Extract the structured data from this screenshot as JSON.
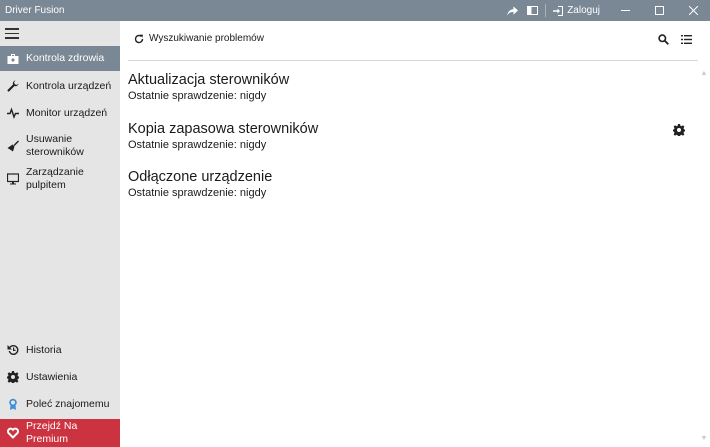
{
  "window": {
    "title": "Driver Fusion",
    "login_label": "Zaloguj"
  },
  "sidebar": {
    "items": [
      {
        "label": "Kontrola zdrowia",
        "icon": "briefcase-icon",
        "active": true
      },
      {
        "label": "Kontrola urządzeń",
        "icon": "wrench-icon"
      },
      {
        "label": "Monitor urządzeń",
        "icon": "pulse-icon"
      },
      {
        "label": "Usuwanie sterowników",
        "icon": "broom-icon"
      },
      {
        "label": "Zarządzanie pulpitem",
        "icon": "monitor-icon"
      }
    ],
    "bottom_items": [
      {
        "label": "Historia",
        "icon": "history-icon"
      },
      {
        "label": "Ustawienia",
        "icon": "gear-icon"
      },
      {
        "label": "Poleć znajomemu",
        "icon": "award-icon"
      },
      {
        "label": "Przejdź Na Premium",
        "icon": "heart-icon"
      }
    ]
  },
  "toolbar": {
    "scan_label": "Wyszukiwanie problemów"
  },
  "sections": [
    {
      "title": "Aktualizacja sterowników",
      "subtitle": "Ostatnie sprawdzenie: nigdy"
    },
    {
      "title": "Kopia zapasowa sterowników",
      "subtitle": "Ostatnie sprawdzenie: nigdy"
    },
    {
      "title": "Odłączone urządzenie",
      "subtitle": "Ostatnie sprawdzenie: nigdy"
    }
  ],
  "colors": {
    "titlebar": "#7a8794",
    "sidebar": "#e5e5e5",
    "active_item": "#7a8794",
    "premium": "#cc3340"
  }
}
